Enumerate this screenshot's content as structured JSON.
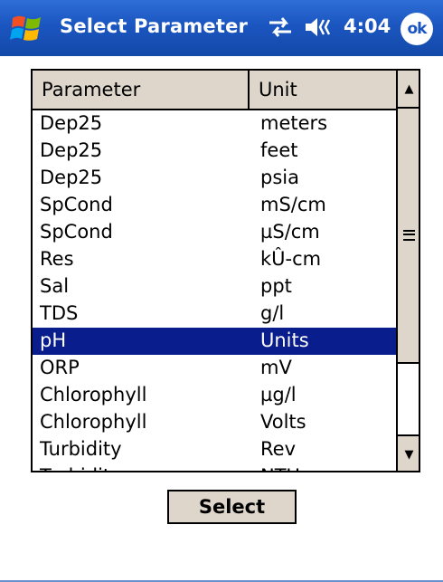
{
  "titlebar": {
    "title": "Select Parameter",
    "clock": "4:04",
    "ok_label": "ok",
    "icons": [
      "windows-flag-icon",
      "connectivity-icon",
      "speaker-volume-icon"
    ],
    "color": "#1b55c0"
  },
  "list": {
    "columns": {
      "parameter": "Parameter",
      "unit": "Unit"
    },
    "rows": [
      {
        "parameter": "Dep25",
        "unit": "meters"
      },
      {
        "parameter": "Dep25",
        "unit": "feet"
      },
      {
        "parameter": "Dep25",
        "unit": "psia"
      },
      {
        "parameter": "SpCond",
        "unit": "mS/cm"
      },
      {
        "parameter": "SpCond",
        "unit": "µS/cm"
      },
      {
        "parameter": "Res",
        "unit": "kÛ-cm"
      },
      {
        "parameter": "Sal",
        "unit": "ppt"
      },
      {
        "parameter": "TDS",
        "unit": "g/l"
      },
      {
        "parameter": "pH",
        "unit": "Units",
        "selected": true
      },
      {
        "parameter": "ORP",
        "unit": "mV"
      },
      {
        "parameter": "Chlorophyll",
        "unit": "µg/l"
      },
      {
        "parameter": "Chlorophyll",
        "unit": "Volts"
      },
      {
        "parameter": "Turbidity",
        "unit": "Rev"
      },
      {
        "parameter": "Turbidity",
        "unit": "NTU"
      }
    ],
    "selection_color": "#0a1d8c",
    "scrollbar_icons": [
      "scroll-up-arrow-icon",
      "scroll-grip-icon",
      "scroll-down-arrow-icon"
    ]
  },
  "actions": {
    "select_label": "Select"
  }
}
